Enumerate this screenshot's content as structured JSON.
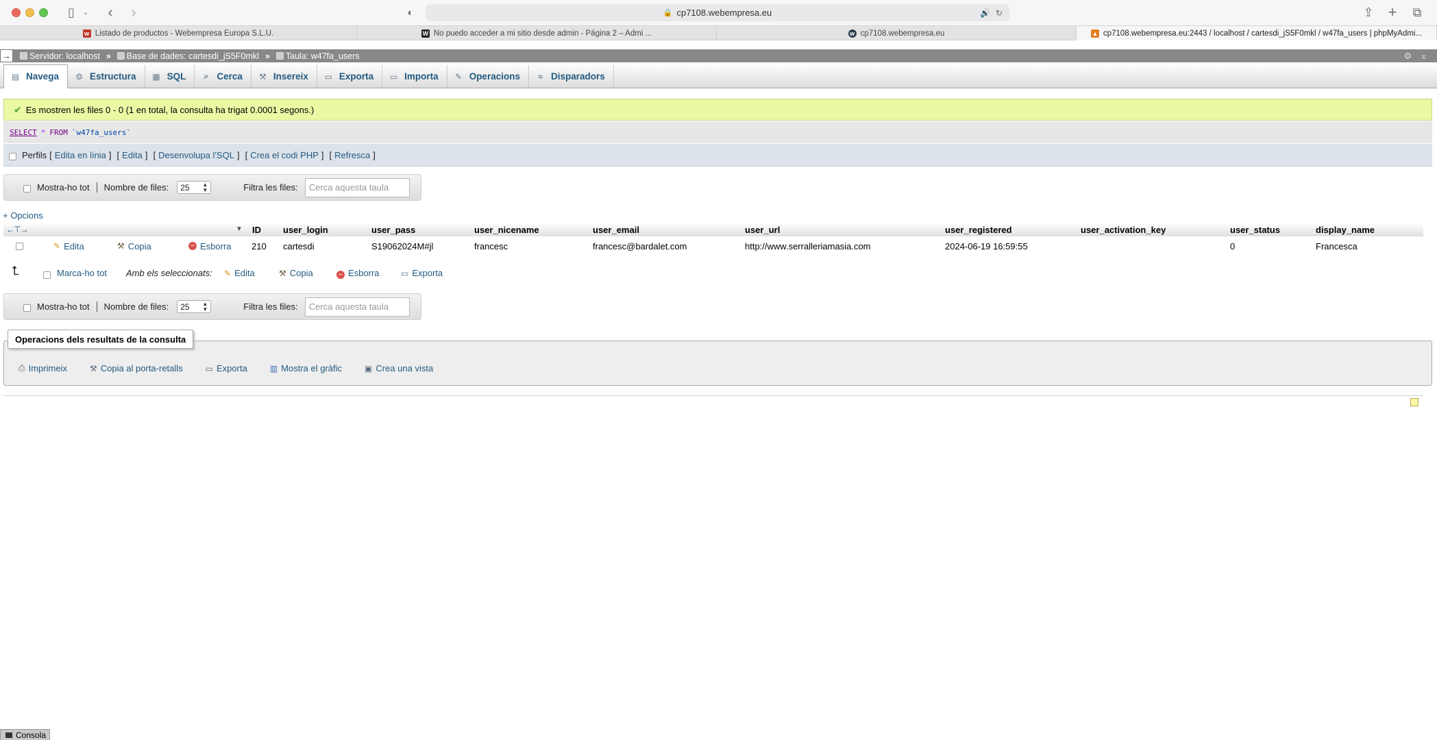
{
  "browser": {
    "address": "cp7108.webempresa.eu",
    "tabs": [
      {
        "label": "Listado de productos - Webempresa Europa S.L.U.",
        "fav_color": "#c0392b",
        "fav_glyph": "w"
      },
      {
        "label": "No puedo acceder a mi sitio desde admin - Página 2 – Admi ...",
        "fav_color": "#222222",
        "fav_glyph": "W"
      },
      {
        "label": "cp7108.webempresa.eu",
        "fav_color": "#2c3e50",
        "fav_glyph": "w"
      },
      {
        "label": "cp7108.webempresa.eu:2443 / localhost / cartesdi_jS5F0mkl / w47fa_users | phpMyAdmi...",
        "fav_color": "#e67e22",
        "fav_glyph": "▲"
      }
    ]
  },
  "breadcrumb": {
    "server": "Servidor: localhost",
    "database": "Base de dades: cartesdi_jS5F0mkl",
    "table": "Taula: w47fa_users",
    "separator": "»"
  },
  "tabs": [
    {
      "label": "Navega",
      "icon": "browse-icon",
      "glyph": "▤"
    },
    {
      "label": "Estructura",
      "icon": "structure-icon",
      "glyph": "⚙"
    },
    {
      "label": "SQL",
      "icon": "sql-icon",
      "glyph": "▦"
    },
    {
      "label": "Cerca",
      "icon": "search-icon",
      "glyph": "🔍"
    },
    {
      "label": "Insereix",
      "icon": "insert-icon",
      "glyph": "⚒"
    },
    {
      "label": "Exporta",
      "icon": "export-icon",
      "glyph": "▭"
    },
    {
      "label": "Importa",
      "icon": "import-icon",
      "glyph": "▭"
    },
    {
      "label": "Operacions",
      "icon": "wrench-icon",
      "glyph": "✎"
    },
    {
      "label": "Disparadors",
      "icon": "triggers-icon",
      "glyph": "≈"
    }
  ],
  "message": {
    "success": "Es mostren les files 0 - 0 (1 en total, la consulta ha trigat 0.0001 segons.)"
  },
  "sql": {
    "select": "SELECT",
    "star": "*",
    "from": "FROM",
    "table": "`w47fa_users`"
  },
  "profile_bar": {
    "profiling": "Perfils",
    "edit_inline": "Edita en línia",
    "edit": "Edita",
    "explain": "Desenvolupa l'SQL",
    "php_code": "Crea el codi PHP",
    "refresh": "Refresca"
  },
  "nav": {
    "show_all": "Mostra-ho tot",
    "rows_label": "Nombre de files:",
    "rows_value": "25",
    "filter_label": "Filtra les files:",
    "filter_placeholder": "Cerca aquesta taula"
  },
  "options_link": "+ Opcions",
  "table": {
    "columns": [
      "ID",
      "user_login",
      "user_pass",
      "user_nicename",
      "user_email",
      "user_url",
      "user_registered",
      "user_activation_key",
      "user_status",
      "display_name"
    ],
    "row_actions": {
      "edit": "Edita",
      "copy": "Copia",
      "delete": "Esborra"
    },
    "rows": [
      [
        "210",
        "cartesdi",
        "S19062024M#jl",
        "francesc",
        "francesc@bardalet.com",
        "http://www.serralleriamasia.com",
        "2024-06-19 16:59:55",
        "",
        "0",
        "Francesca"
      ]
    ]
  },
  "bulk": {
    "check_all": "Marca-ho tot",
    "with_selected": "Amb els seleccionats:",
    "edit": "Edita",
    "copy": "Copia",
    "delete": "Esborra",
    "export": "Exporta"
  },
  "query_ops": {
    "legend": "Operacions dels resultats de la consulta",
    "items": [
      {
        "label": "Imprimeix",
        "icon": "print-icon"
      },
      {
        "label": "Copia al porta-retalls",
        "icon": "clipboard-icon"
      },
      {
        "label": "Exporta",
        "icon": "export-icon"
      },
      {
        "label": "Mostra el gràfic",
        "icon": "chart-icon"
      },
      {
        "label": "Crea una vista",
        "icon": "view-icon"
      }
    ]
  },
  "console": "Consola"
}
